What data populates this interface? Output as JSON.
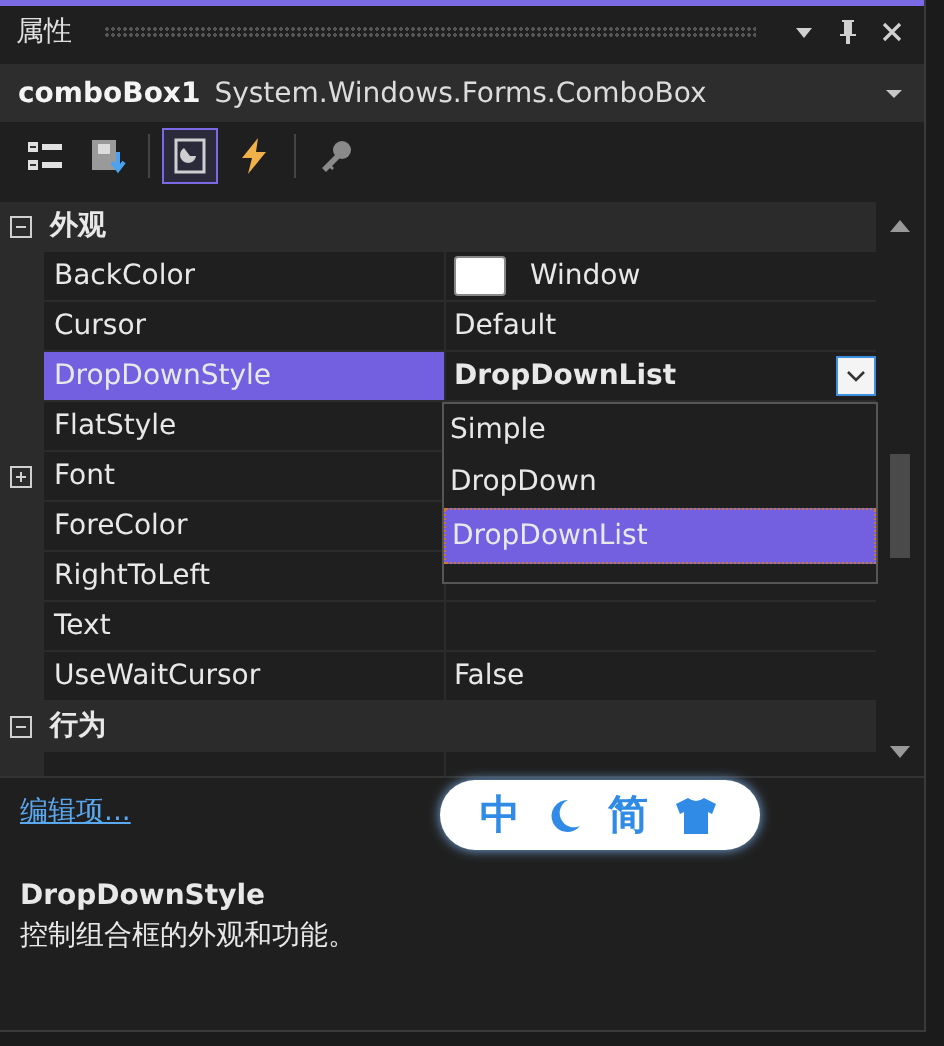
{
  "panel": {
    "title": "属性"
  },
  "object_selector": {
    "name": "comboBox1",
    "type": "System.Windows.Forms.ComboBox"
  },
  "toolbar": [
    {
      "kind": "categorized",
      "selected": false
    },
    {
      "kind": "alphabetical",
      "selected": false
    },
    {
      "kind": "properties",
      "selected": true
    },
    {
      "kind": "events",
      "selected": false
    },
    {
      "kind": "pages",
      "selected": false
    }
  ],
  "categories": [
    {
      "name": "外观",
      "expanded": true,
      "properties": [
        {
          "name": "BackColor",
          "kind": "color",
          "value": "Window",
          "selected": false,
          "bold": false
        },
        {
          "name": "Cursor",
          "kind": "text",
          "value": "Default",
          "selected": false,
          "bold": false
        },
        {
          "name": "DropDownStyle",
          "kind": "choice",
          "value": "DropDownList",
          "selected": true,
          "bold": true,
          "dropdown": [
            {
              "label": "Simple",
              "selected": false
            },
            {
              "label": "DropDown",
              "selected": false
            },
            {
              "label": "DropDownList",
              "selected": true
            }
          ]
        },
        {
          "name": "FlatStyle",
          "kind": "text",
          "selected": false
        },
        {
          "name": "Font",
          "kind": "text",
          "expanded": false,
          "selected": false
        },
        {
          "name": "ForeColor",
          "kind": "text",
          "selected": false
        },
        {
          "name": "RightToLeft",
          "kind": "text",
          "selected": false
        },
        {
          "name": "Text",
          "kind": "text",
          "selected": false
        },
        {
          "name": "UseWaitCursor",
          "kind": "text",
          "value": "False",
          "selected": false,
          "bold": false
        }
      ]
    },
    {
      "name": "行为",
      "expanded": true
    }
  ],
  "description": {
    "link": "编辑项...",
    "title": "DropDownStyle",
    "text": "控制组合框的外观和功能。"
  },
  "ime_bar": {
    "items": [
      {
        "kind": "text",
        "label": "中"
      },
      {
        "kind": "moon"
      },
      {
        "kind": "text",
        "label": "简"
      },
      {
        "kind": "shirt"
      }
    ]
  }
}
